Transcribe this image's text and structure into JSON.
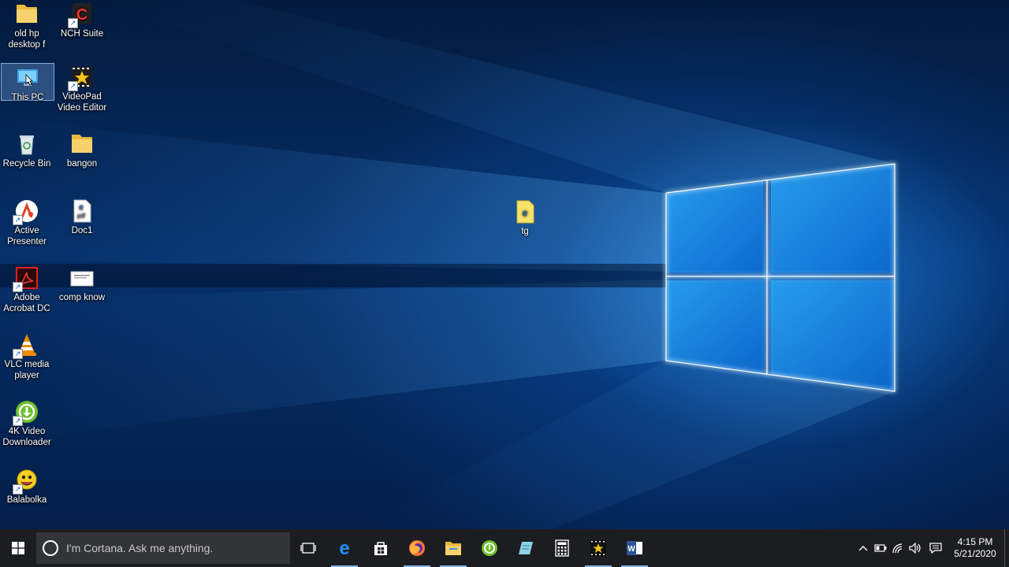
{
  "desktop": {
    "icons": [
      {
        "label": "old hp desktop f",
        "icon": "folder-icon"
      },
      {
        "label": "NCH Suite",
        "icon": "nch-suite-icon"
      },
      {
        "label": "This PC",
        "icon": "this-pc-icon",
        "selected": true
      },
      {
        "label": "VideoPad Video Editor",
        "icon": "videopad-icon"
      },
      {
        "label": "Recycle Bin",
        "icon": "recycle-bin-icon"
      },
      {
        "label": "bangon",
        "icon": "folder-icon"
      },
      {
        "label": "Active Presenter",
        "icon": "active-presenter-icon"
      },
      {
        "label": "Doc1",
        "icon": "pdf-document-icon"
      },
      {
        "label": "Adobe Acrobat DC",
        "icon": "adobe-acrobat-icon"
      },
      {
        "label": "comp know",
        "icon": "document-thumbnail-icon"
      },
      {
        "label": "VLC media player",
        "icon": "vlc-icon"
      },
      {
        "label": "4K Video Downloader",
        "icon": "4k-video-downloader-icon"
      },
      {
        "label": "Balabolka",
        "icon": "balabolka-icon"
      },
      {
        "label": "tg",
        "icon": "html-file-icon"
      }
    ]
  },
  "taskbar": {
    "search_placeholder": "I'm Cortana. Ask me anything.",
    "pinned": [
      {
        "icon": "task-view-icon"
      },
      {
        "icon": "edge-icon",
        "active": true
      },
      {
        "icon": "store-icon"
      },
      {
        "icon": "firefox-icon",
        "active": true
      },
      {
        "icon": "file-explorer-icon",
        "active": true
      },
      {
        "icon": "4k-video-downloader-icon"
      },
      {
        "icon": "notepad-icon"
      },
      {
        "icon": "calculator-icon"
      },
      {
        "icon": "videopad-icon",
        "active": true
      },
      {
        "icon": "word-icon",
        "active": true
      }
    ],
    "clock_time": "4:15 PM",
    "clock_date": "5/21/2020"
  },
  "colors": {
    "taskbar_bg": "#1c1d21",
    "accent": "#0078d7",
    "wallpaper_glow": "#3fa9ff"
  }
}
